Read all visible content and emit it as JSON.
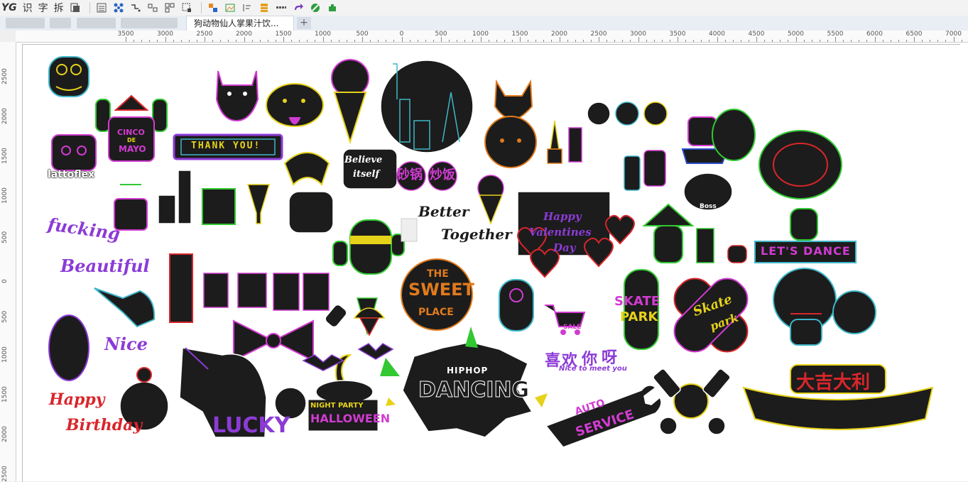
{
  "toolbar": {
    "items": [
      "YG",
      "识",
      "字",
      "拆"
    ],
    "colors": {
      "orange": "#e58a1f",
      "green": "#2e9e3e",
      "blue": "#2a66c5",
      "purple": "#7a3cc6"
    }
  },
  "tabs": {
    "active_tab": "狗动物仙人掌果汁饮...",
    "add_label": "+"
  },
  "hruler": {
    "labels": [
      "3500",
      "3000",
      "2500",
      "2000",
      "1500",
      "1000",
      "500",
      "0",
      "500",
      "1000",
      "1500",
      "2000",
      "2500",
      "3000",
      "3500",
      "4000",
      "4500",
      "5000",
      "5500",
      "6000",
      "6500",
      "7000"
    ]
  },
  "vruler": {
    "labels": [
      "2500",
      "2000",
      "1500",
      "1000",
      "500",
      "0",
      "500",
      "1000",
      "1500",
      "2000",
      "2500"
    ]
  },
  "stickers": {
    "thank_you": "THANK YOU!",
    "cinco": "CINCO",
    "de": "DE",
    "mayo": "MAYO",
    "lattoflex": "lattoflex",
    "fucking": "fucking",
    "beautiful": "Beautiful",
    "believe": "Believe",
    "itself": "itself",
    "shaguo": "砂锅",
    "chaofan": "炒饭",
    "better": "Better",
    "together": "Together",
    "happy_valentines": "Happy",
    "valentines": "Valentines",
    "day": "Day",
    "lets_dance": "LET'S DANCE",
    "the": "THE",
    "sweet": "SWEET",
    "place": "PLACE",
    "skate_park1": "SKATE",
    "skate_park2": "PARK",
    "skate_script": "Skate",
    "park_script": "park",
    "nice": "Nice",
    "happy_birthday1": "Happy",
    "happy_birthday2": "Birthday",
    "lucky": "LUCKY",
    "night_party": "NIGHT PARTY",
    "halloween": "HALLOWEEN",
    "hiphop": "HIPHOP",
    "dancing": "DANCING",
    "xi": "喜",
    "huan": "欢",
    "ni": "你",
    "ya": "呀",
    "nice_to_meet": "Nice to meet you",
    "auto": "AUTO",
    "service": "SERVICE",
    "dajidali": "大吉大利",
    "sale": "SALE",
    "boss": "Boss"
  },
  "neon_colors": {
    "yellow": "#e6d21a",
    "pink": "#d13bd1",
    "cyan": "#3fb6c8",
    "green": "#32c832",
    "red": "#d8262b",
    "orange": "#e07a1d",
    "purple": "#8c3bd6",
    "body": "#1c1c1c"
  }
}
